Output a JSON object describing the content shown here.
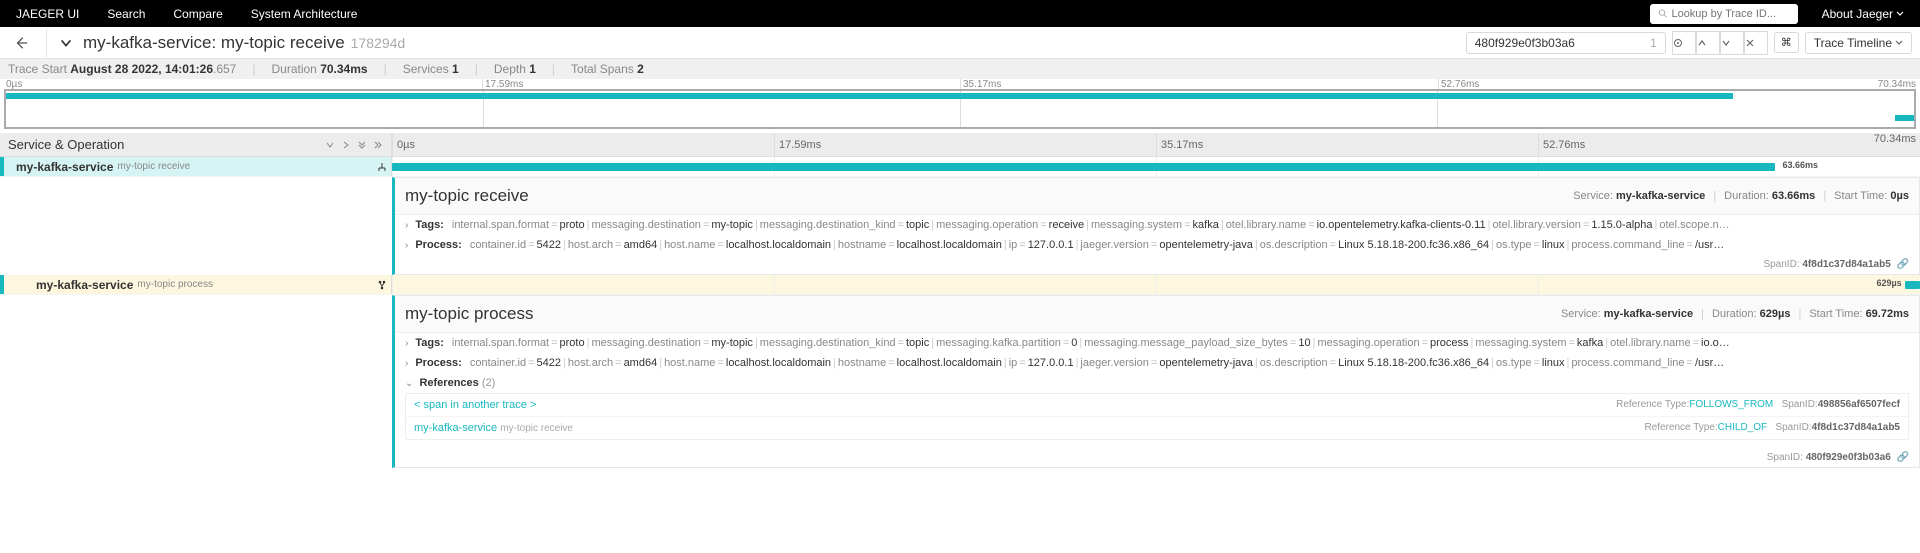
{
  "nav": {
    "brand": "JAEGER UI",
    "items": [
      "Search",
      "Compare",
      "System Architecture"
    ],
    "search_placeholder": "Lookup by Trace ID...",
    "about": "About Jaeger"
  },
  "trace": {
    "title": "my-kafka-service: my-topic receive",
    "short_id": "178294d",
    "search_value": "480f929e0f3b03a6",
    "search_count": "1",
    "timeline_label": "Trace Timeline"
  },
  "meta": {
    "start_label": "Trace Start",
    "start_value": "August 28 2022, 14:01:26",
    "start_ms": ".657",
    "duration_label": "Duration",
    "duration_value": "70.34ms",
    "services_label": "Services",
    "services_value": "1",
    "depth_label": "Depth",
    "depth_value": "1",
    "spans_label": "Total Spans",
    "spans_value": "2"
  },
  "ticks": [
    "0µs",
    "17.59ms",
    "35.17ms",
    "52.76ms",
    "70.34ms"
  ],
  "header": {
    "service_op": "Service & Operation"
  },
  "spans": [
    {
      "service": "my-kafka-service",
      "operation": "my-topic receive",
      "duration": "63.66ms",
      "detail": {
        "title": "my-topic receive",
        "service_label": "Service:",
        "service": "my-kafka-service",
        "duration_label": "Duration:",
        "duration": "63.66ms",
        "start_label": "Start Time:",
        "start": "0µs",
        "tags_label": "Tags:",
        "tags": [
          {
            "k": "internal.span.format",
            "v": "proto"
          },
          {
            "k": "messaging.destination",
            "v": "my-topic"
          },
          {
            "k": "messaging.destination_kind",
            "v": "topic"
          },
          {
            "k": "messaging.operation",
            "v": "receive"
          },
          {
            "k": "messaging.system",
            "v": "kafka"
          },
          {
            "k": "otel.library.name",
            "v": "io.opentelemetry.kafka-clients-0.11"
          },
          {
            "k": "otel.library.version",
            "v": "1.15.0-alpha"
          },
          {
            "k": "otel.scope.n…",
            "v": ""
          }
        ],
        "process_label": "Process:",
        "process": [
          {
            "k": "container.id",
            "v": "5422"
          },
          {
            "k": "host.arch",
            "v": "amd64"
          },
          {
            "k": "host.name",
            "v": "localhost.localdomain"
          },
          {
            "k": "hostname",
            "v": "localhost.localdomain"
          },
          {
            "k": "ip",
            "v": "127.0.0.1"
          },
          {
            "k": "jaeger.version",
            "v": "opentelemetry-java"
          },
          {
            "k": "os.description",
            "v": "Linux 5.18.18-200.fc36.x86_64"
          },
          {
            "k": "os.type",
            "v": "linux"
          },
          {
            "k": "process.command_line",
            "v": "/usr…"
          }
        ],
        "spanid_label": "SpanID:",
        "spanid": "4f8d1c37d84a1ab5"
      }
    },
    {
      "service": "my-kafka-service",
      "operation": "my-topic process",
      "duration": "629µs",
      "detail": {
        "title": "my-topic process",
        "service_label": "Service:",
        "service": "my-kafka-service",
        "duration_label": "Duration:",
        "duration": "629µs",
        "start_label": "Start Time:",
        "start": "69.72ms",
        "tags_label": "Tags:",
        "tags": [
          {
            "k": "internal.span.format",
            "v": "proto"
          },
          {
            "k": "messaging.destination",
            "v": "my-topic"
          },
          {
            "k": "messaging.destination_kind",
            "v": "topic"
          },
          {
            "k": "messaging.kafka.partition",
            "v": "0"
          },
          {
            "k": "messaging.message_payload_size_bytes",
            "v": "10"
          },
          {
            "k": "messaging.operation",
            "v": "process"
          },
          {
            "k": "messaging.system",
            "v": "kafka"
          },
          {
            "k": "otel.library.name",
            "v": "io.o…"
          }
        ],
        "process_label": "Process:",
        "process": [
          {
            "k": "container.id",
            "v": "5422"
          },
          {
            "k": "host.arch",
            "v": "amd64"
          },
          {
            "k": "host.name",
            "v": "localhost.localdomain"
          },
          {
            "k": "hostname",
            "v": "localhost.localdomain"
          },
          {
            "k": "ip",
            "v": "127.0.0.1"
          },
          {
            "k": "jaeger.version",
            "v": "opentelemetry-java"
          },
          {
            "k": "os.description",
            "v": "Linux 5.18.18-200.fc36.x86_64"
          },
          {
            "k": "os.type",
            "v": "linux"
          },
          {
            "k": "process.command_line",
            "v": "/usr…"
          }
        ],
        "refs_label": "References",
        "refs_count": "(2)",
        "references": [
          {
            "left_main": "< span in another trace >",
            "left_sub": "",
            "type_label": "Reference Type:",
            "type": "FOLLOWS_FROM",
            "spanid_label": "SpanID:",
            "spanid": "498856af6507fecf"
          },
          {
            "left_main": "my-kafka-service",
            "left_sub": "my-topic receive",
            "type_label": "Reference Type:",
            "type": "CHILD_OF",
            "spanid_label": "SpanID:",
            "spanid": "4f8d1c37d84a1ab5"
          }
        ],
        "spanid_label": "SpanID:",
        "spanid": "480f929e0f3b03a6"
      }
    }
  ]
}
